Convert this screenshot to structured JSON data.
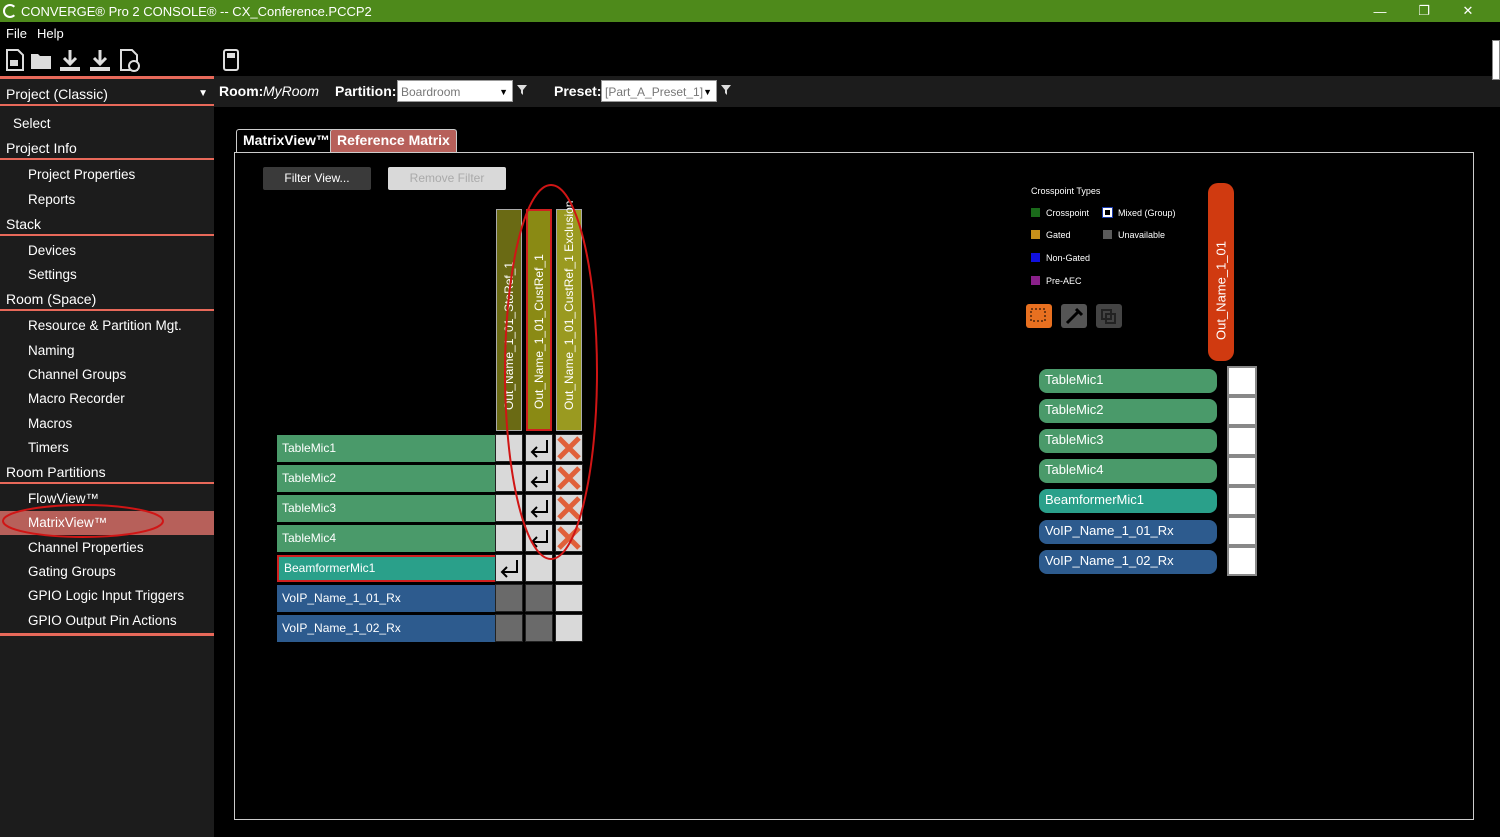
{
  "window": {
    "title": "CONVERGE® Pro 2 CONSOLE®  -- CX_Conference.PCCP2",
    "minimize": "—",
    "maximize": "❐",
    "close": "✕"
  },
  "menu": {
    "file": "File",
    "help": "Help"
  },
  "sidebar": {
    "project": "Project (Classic)",
    "select": "Select",
    "project_info": "Project Info",
    "project_properties": "Project Properties",
    "reports": "Reports",
    "stack": "Stack",
    "devices": "Devices",
    "settings": "Settings",
    "room": "Room (Space)",
    "resource": "Resource & Partition Mgt.",
    "naming": "Naming",
    "channel_groups": "Channel Groups",
    "macro_recorder": "Macro Recorder",
    "macros": "Macros",
    "timers": "Timers",
    "room_partitions": "Room Partitions",
    "flowview": "FlowView™",
    "matrixview": "MatrixView™",
    "channel_properties": "Channel Properties",
    "gating_groups": "Gating Groups",
    "gpio_in": "GPIO Logic Input Triggers",
    "gpio_out": "GPIO Output Pin Actions"
  },
  "topbar": {
    "room_label": "Room:",
    "room_value": "MyRoom",
    "partition_label": "Partition:",
    "partition_value": "Boardroom",
    "preset_label": "Preset:",
    "preset_value": "[Part_A_Preset_1]"
  },
  "tabs": {
    "matrix": "MatrixView™",
    "reference": "Reference Matrix"
  },
  "buttons": {
    "filter": "Filter View...",
    "remove": "Remove Filter"
  },
  "columns": [
    "Out_Name_1_01_StoRef_1",
    "Out_Name_1_01_CustRef_1",
    "Out_Name_1_01_CustRef_1 Exclusion"
  ],
  "rows": [
    "TableMic1",
    "TableMic2",
    "TableMic3",
    "TableMic4",
    "BeamformerMic1",
    "VoIP_Name_1_01_Rx",
    "VoIP_Name_1_02_Rx"
  ],
  "legend": {
    "title": "Crosspoint Types",
    "crosspoint": "Crosspoint",
    "mixed": "Mixed (Group)",
    "gated": "Gated",
    "unavailable": "Unavailable",
    "nongated": "Non-Gated",
    "preaec": "Pre-AEC"
  },
  "right": {
    "output": "Out_Name_1_01"
  },
  "colors": {
    "accent": "#e8695a",
    "titlebar": "#4e8a1b",
    "green_row": "#4a9a6a",
    "teal_row": "#2aa08a",
    "blue_row": "#2d5b8e"
  }
}
